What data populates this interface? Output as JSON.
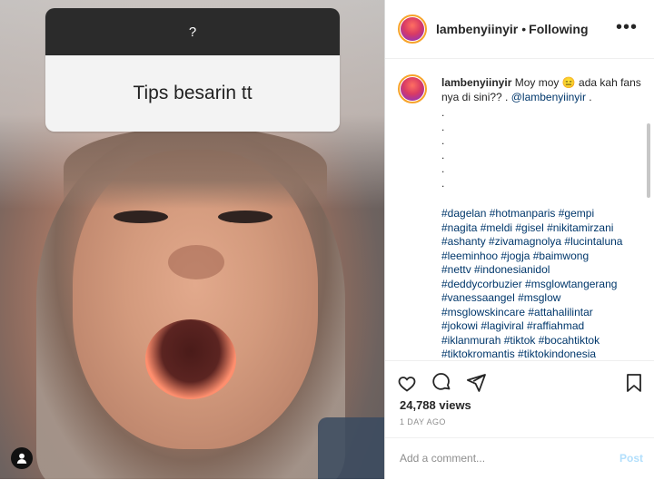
{
  "media": {
    "question_symbol": "?",
    "question_text": "Tips besarin tt"
  },
  "post": {
    "username": "lambenyiinyir",
    "follow_status": "Following",
    "bullet": "•",
    "more_label": "•••",
    "caption": {
      "username": "lambenyiinyir",
      "text_before_emoji": "Moy moy",
      "emoji": "😑",
      "text_after_emoji": "ada kah fans nya di sini?? .",
      "mention": "@lambenyiinyir",
      "after_mention": ".",
      "dots": [
        ".",
        ".",
        ".",
        ".",
        ".",
        "."
      ],
      "hashtags": [
        "#dagelan #hotmanparis #gempi",
        "#nagita #meldi #gisel #nikitamirzani",
        "#ashanty #zivamagnolya #lucintaluna",
        "#leeminhoo #jogja #baimwong",
        "#nettv #indonesianidol",
        "#deddycorbuzier #msglowtangerang",
        "#vanessaangel #msglow",
        "#msglowskincare #attahalilintar",
        "#jokowi #lagiviral #raffiahmad",
        "#iklanmurah #tiktok #bocahtiktok",
        "#tiktokromantis #tiktokindonesia"
      ]
    },
    "views": "24,788 views",
    "time_ago": "1 DAY AGO",
    "comment_placeholder": "Add a comment...",
    "post_label": "Post"
  }
}
